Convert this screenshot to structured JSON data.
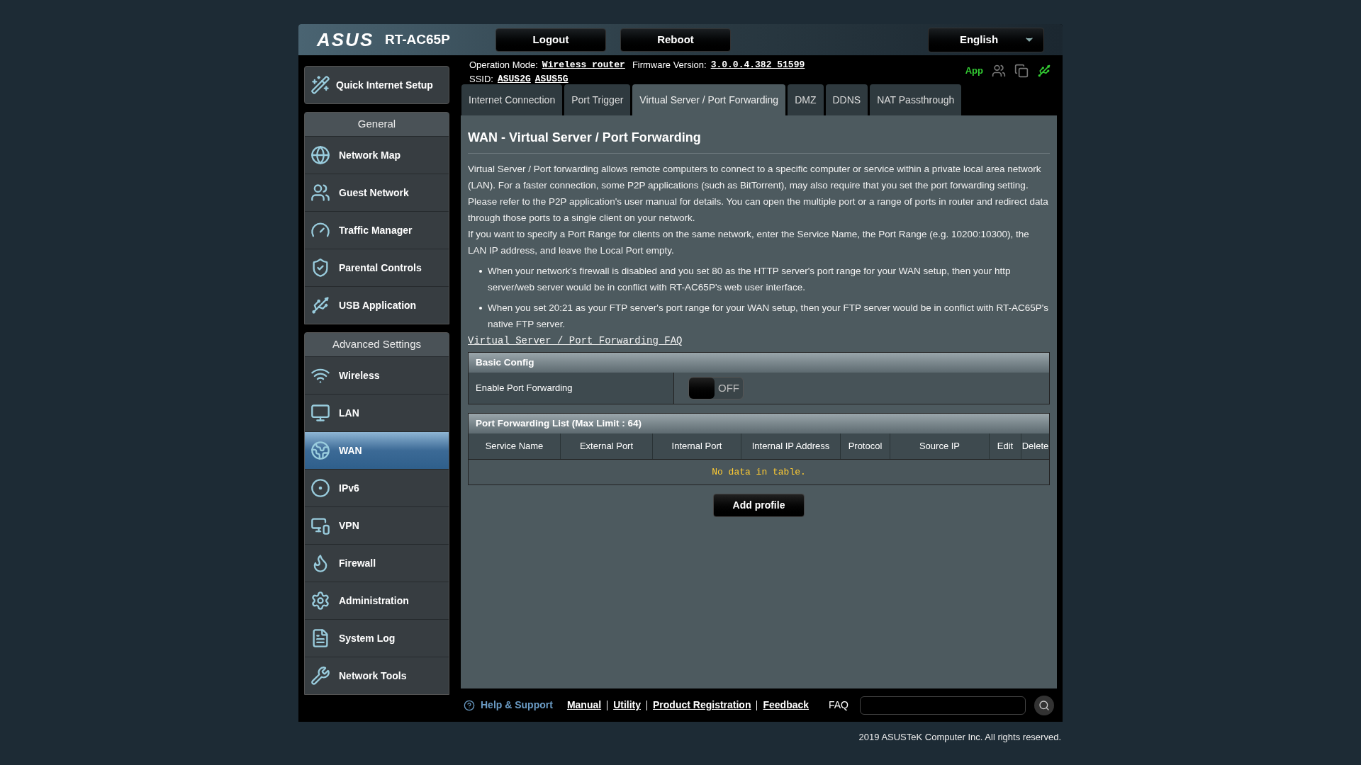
{
  "header": {
    "brand": "ASUS",
    "model": "RT-AC65P",
    "buttons": [
      "Logout",
      "Reboot"
    ],
    "language": "English"
  },
  "status": {
    "operation_mode_label": "Operation Mode:",
    "operation_mode": "Wireless router",
    "firmware_label": "Firmware Version:",
    "firmware": "3.0.0.4.382_51599",
    "ssid_label": "SSID:",
    "ssids": [
      "ASUS2G",
      "ASUS5G"
    ],
    "app": "App"
  },
  "sidebar": {
    "quick_setup": "Quick Internet Setup",
    "sections": [
      {
        "title": "General",
        "items": [
          {
            "label": "Network Map",
            "selected": false
          },
          {
            "label": "Guest Network",
            "selected": false
          },
          {
            "label": "Traffic Manager",
            "selected": false
          },
          {
            "label": "Parental Controls",
            "selected": false
          },
          {
            "label": "USB Application",
            "selected": false
          }
        ]
      },
      {
        "title": "Advanced Settings",
        "items": [
          {
            "label": "Wireless",
            "selected": false
          },
          {
            "label": "LAN",
            "selected": false
          },
          {
            "label": "WAN",
            "selected": true
          },
          {
            "label": "IPv6",
            "selected": false
          },
          {
            "label": "VPN",
            "selected": false
          },
          {
            "label": "Firewall",
            "selected": false
          },
          {
            "label": "Administration",
            "selected": false
          },
          {
            "label": "System Log",
            "selected": false
          },
          {
            "label": "Network Tools",
            "selected": false
          }
        ]
      }
    ]
  },
  "tabs": [
    {
      "label": "Internet Connection",
      "selected": false
    },
    {
      "label": "Port Trigger",
      "selected": false
    },
    {
      "label": "Virtual Server / Port Forwarding",
      "selected": true
    },
    {
      "label": "DMZ",
      "selected": false
    },
    {
      "label": "DDNS",
      "selected": false
    },
    {
      "label": "NAT Passthrough",
      "selected": false
    }
  ],
  "content": {
    "title": "WAN - Virtual Server / Port Forwarding",
    "paragraphs": [
      "Virtual Server / Port forwarding allows remote computers to connect to a specific computer or service within a private local area network (LAN). For a faster connection, some P2P applications (such as BitTorrent), may also require that you set the port forwarding setting. Please refer to the P2P application's user manual for details. You can open the multiple port or a range of ports in router and redirect data through those ports to a single client on your network.",
      "If you want to specify a Port Range for clients on the same network, enter the Service Name, the Port Range (e.g. 10200:10300), the LAN IP address, and leave the Local Port empty."
    ],
    "bullets": [
      "When your network's firewall is disabled and you set 80 as the HTTP server's port range for your WAN setup, then your http server/web server would be in conflict with RT-AC65P's web user interface.",
      "When you set 20:21 as your FTP server's port range for your WAN setup, then your FTP server would be in conflict with RT-AC65P's native FTP server."
    ],
    "faq_link": "Virtual Server / Port Forwarding FAQ",
    "basic_config": {
      "title": "Basic Config",
      "label": "Enable Port Forwarding",
      "on": false,
      "toggle_text": "OFF"
    },
    "list": {
      "title": "Port Forwarding List (Max Limit : 64)",
      "columns": [
        "Service Name",
        "External Port",
        "Internal Port",
        "Internal IP Address",
        "Protocol",
        "Source IP",
        "Edit",
        "Delete"
      ],
      "empty_text": "No data in table."
    },
    "add_button": "Add profile"
  },
  "footer": {
    "help": "Help & Support",
    "links": [
      "Manual",
      "Utility",
      "Product Registration",
      "Feedback"
    ],
    "faq_label": "FAQ",
    "copyright": "2019 ASUSTeK Computer Inc. All rights reserved."
  }
}
